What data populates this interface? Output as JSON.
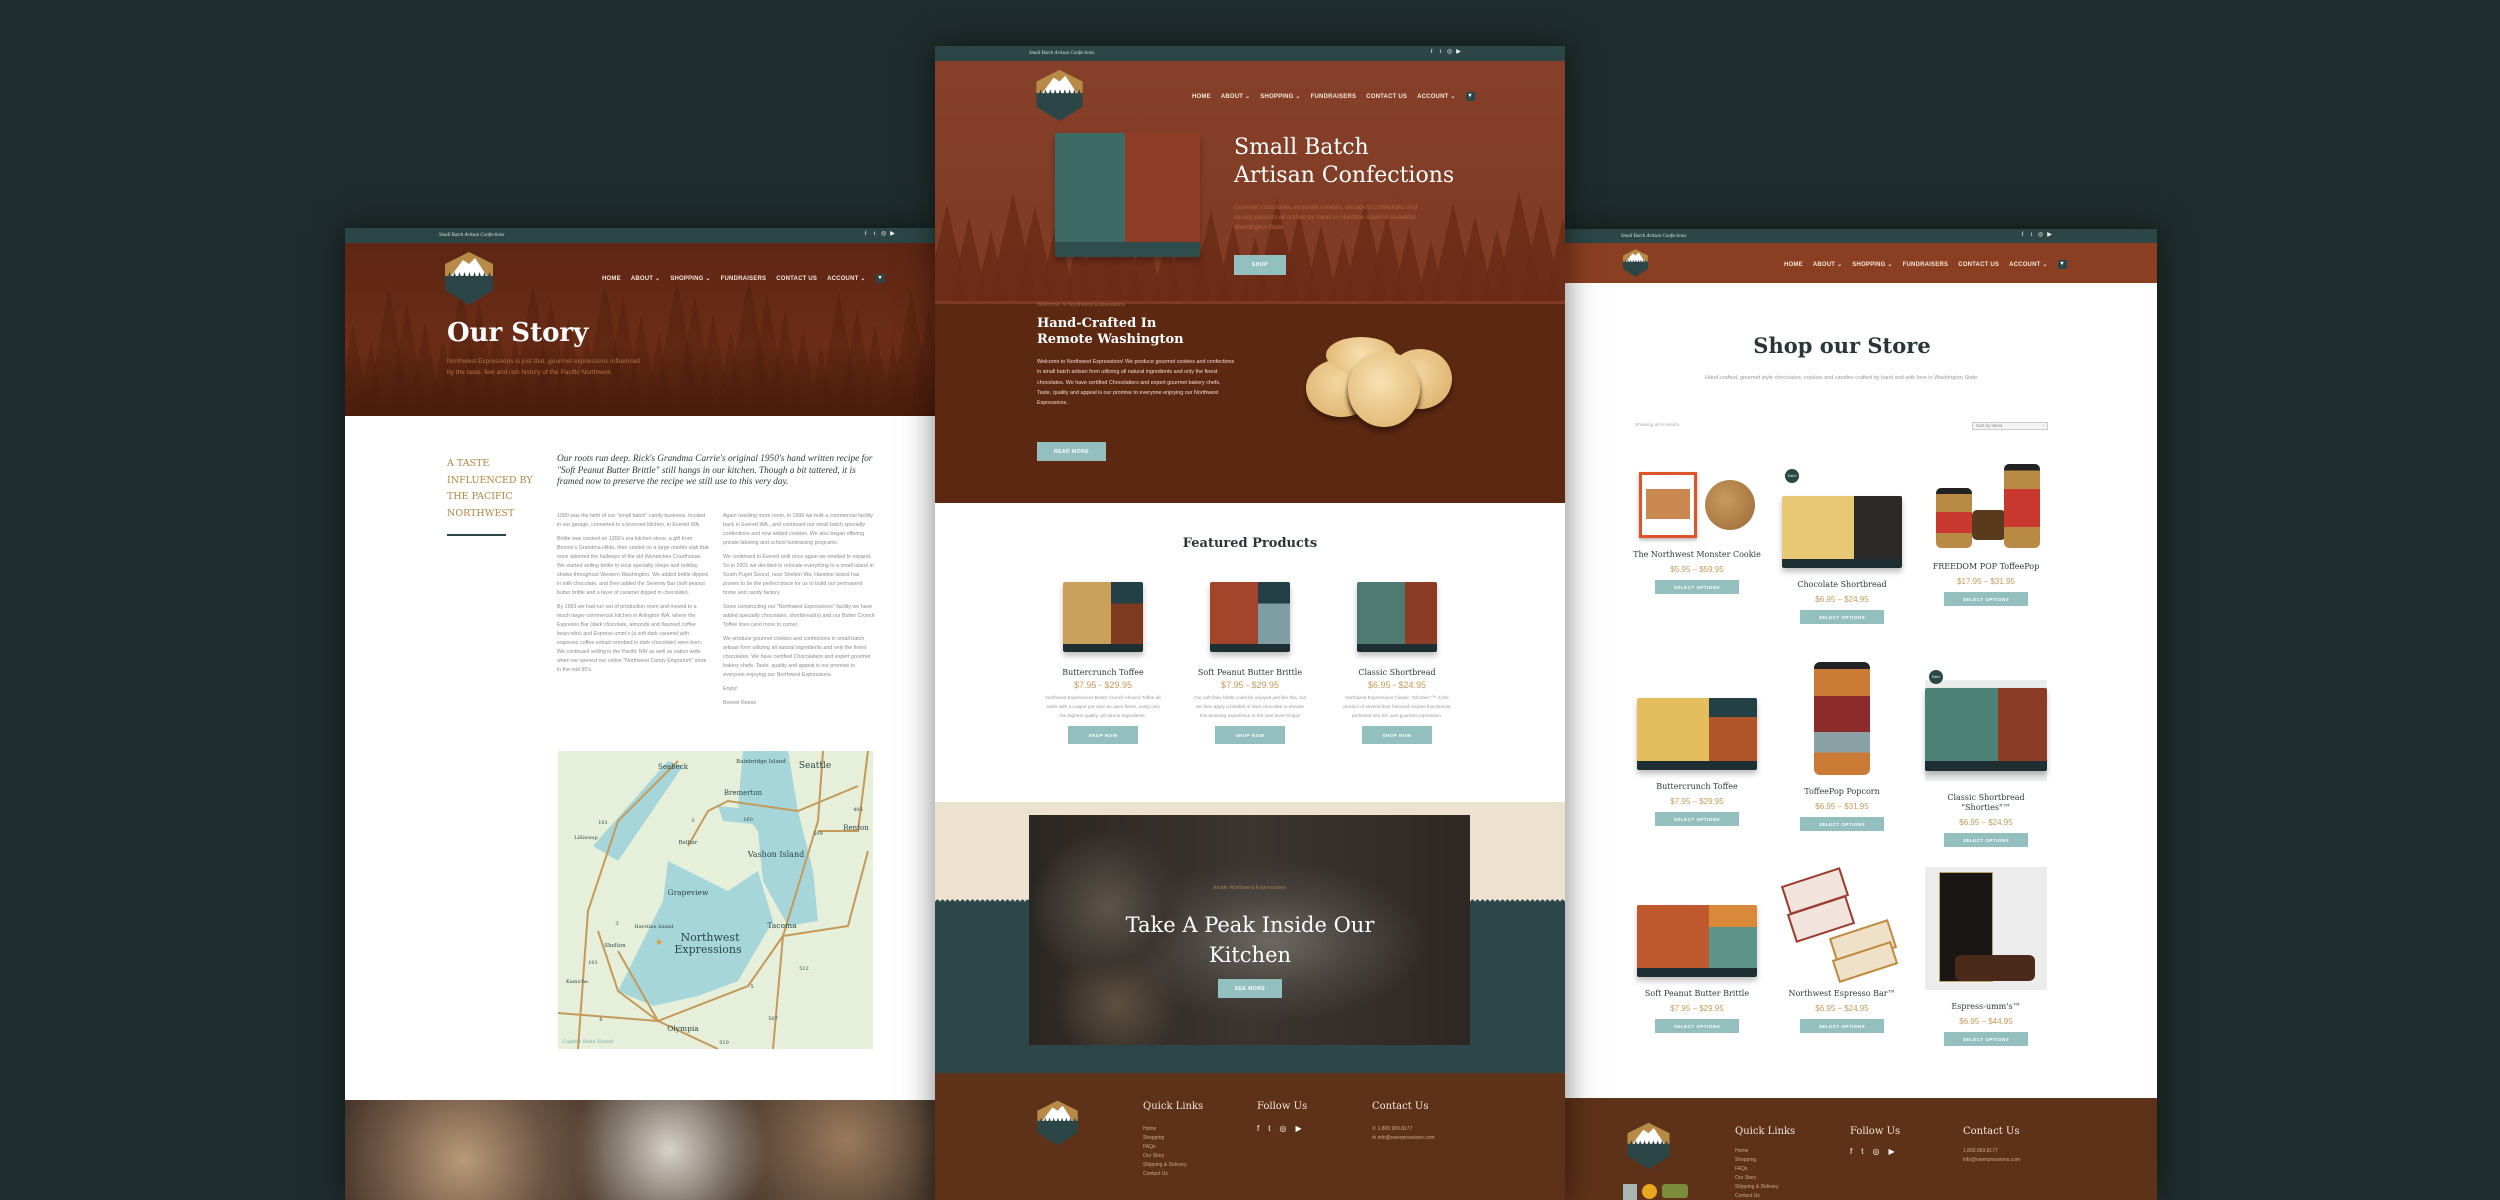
{
  "brand": {
    "name": "Northwest Expressions",
    "tagline": "Small Batch Artisan Confections",
    "logo_sub": "Cookies & Confections"
  },
  "colors": {
    "background": "#1f2c2d",
    "topbar": "#2c4647",
    "brown": "#823a1f",
    "dark_brown": "#5c2812",
    "footer": "#5e3219",
    "button": "#94bfbf",
    "gold": "#c49a5a",
    "cream": "#ede2d0"
  },
  "nav": {
    "items": [
      "HOME",
      "ABOUT",
      "SHOPPING",
      "FUNDRAISERS",
      "CONTACT US",
      "ACCOUNT"
    ],
    "cart_icon": "cart-icon",
    "cart_count": "0"
  },
  "social_icons": [
    "facebook-icon",
    "twitter-icon",
    "instagram-icon",
    "youtube-icon"
  ],
  "story": {
    "title": "Our Story",
    "subtitle": "Northwest Expressions is just that, gourmet expressions influenced by the taste, feel and rich history of the Pacific Northwest.",
    "side_heading": "A TASTE INFLUENCED BY THE PACIFIC NORTHWEST",
    "quote": "Our roots run deep. Rick's Grandma Carrie's original 1950's hand written recipe for \"Soft Peanut Butter Brittle\" still hangs in our kitchen. Though a bit tattered, it is framed now to preserve the recipe we still use to this very day.",
    "col1": [
      "1990 was the birth of our \"small batch\" candy business, located in our garage, converted to a licensed kitchen, in Everett WA.",
      "Brittle was cooked on 1950's era kitchen stove, a gift from Bonnie's Grandma Hilda, then cooled on a large marble slab that once adorned the hallways of the old Wenatchee Courthouse. We started selling brittle in local specialty shops and holiday shows throughout Western Washington. We added brittle dipped in milk chocolate, and then added the Serenity Bar (soft peanut butter brittle and a layer of caramel dipped in chocolate).",
      "By 1993 we had run out of production room and moved to a much larger commercial kitchen in Arlington WA, where the Espresso Bar (dark chocolate, almonds and flavored coffee bean nibs) and Espress-umm's (a soft dark caramel with espresso coffee extract enrobed in dark chocolate) were born. We continued selling in the Pacific NW as well as nation wide when we opened our online \"Northwest Candy Emporium\" store in the mid 90's."
    ],
    "col2": [
      "Again needing more room, in 1996 we built a commercial facility back in Everett WA., and continued our small batch specialty confections and now added cookies. We also began offering private labeling and school fundraising programs.",
      "We continued in Everett until once again we needed to expand. So in 2001 we decided to relocate everything to a small island in South Puget Sound, near Shelton Wa. Harstine Island has proven to be the perfect place for us to build our permanent home and candy factory.",
      "Since constructing our \"Northwest Expressions\" facility we have added specialty chocolates, shortbread(s) and our Butter Crunch Toffee lines (and more to come).",
      "We produce gourmet cookies and confections in small batch artisan form utilizing all natural ingredients and only the finest chocolates. We have certified Chocolatiers and expert gourmet bakery chefs. Taste, quality and appeal is our promise to everyone enjoying our Northwest Expressions.",
      "Enjoy!",
      "Bonnie Reese"
    ],
    "map_labels": [
      "Seabeck",
      "Bainbridge Island",
      "Seattle",
      "Bremerton",
      "101",
      "3",
      "160",
      "509",
      "Renton",
      "405",
      "Lilliwaup",
      "Belfair",
      "Vashon Island",
      "Grapeview",
      "Tacoma",
      "3",
      "Harstine Island",
      "Northwest",
      "Expressions",
      "Shelton",
      "101",
      "512",
      "Kamiche",
      "5",
      "8",
      "Olympia",
      "507",
      "Capitol State Forest",
      "510"
    ]
  },
  "home": {
    "hero_title_1": "Small Batch",
    "hero_title_2": "Artisan Confections",
    "hero_text": "Gourmet chocolates, exquisite cookies, decadent confections and savory popcorn all crafted by hand on Harstine Island in beautiful Washington State.",
    "shop_button": "SHOP",
    "welcome_label": "Welcome To Northwest Expressions",
    "welcome_title": "Hand-Crafted In Remote Washington",
    "welcome_text": "Welcome to Northwest Expressions! We produce gourmet cookies and confections in small batch artisan form utilizing all natural ingredients and only the finest chocolates. We have certified Chocolatiers and expert gourmet bakery chefs. Taste, quality and appeal is our promise to everyone enjoying our Northwest Expressions.",
    "read_more": "READ MORE",
    "featured_title": "Featured Products",
    "featured": [
      {
        "name": "Buttercrunch Toffee",
        "price": "$7.95 - $29.95",
        "desc": "Northwest Expressions Butter Crunch Almond Toffee all starts with a copper pot over an open flame, using only the highest quality, all natural ingredients.",
        "button": "SHOP NOW"
      },
      {
        "name": "Soft Peanut Butter Brittle",
        "price": "$7.95 - $29.95",
        "desc": "Our soft flaky brittle could be enjoyed just like this, but we then apply a blanket of dark chocolate to elevate this amazing experience to the next level! Enjoy!",
        "button": "SHOP NOW"
      },
      {
        "name": "Classic Shortbread",
        "price": "$6.95 - $24.95",
        "desc": "Northwest Expressions Classic \"Shorties\"™ is the product of several time honored recipes that Bonnie perfected into her own gourmet expression.",
        "button": "SHOP NOW"
      }
    ],
    "kitchen_label": "Inside Northwest Expressions",
    "kitchen_title": "Take A Peak Inside Our Kitchen",
    "see_more": "SEE MORE"
  },
  "shop": {
    "title": "Shop our Store",
    "subtitle": "Hand-crafted, gourmet style chocolates, cookies and candies crafted by hand and with love in Washington State.",
    "results": "Showing all 9 results",
    "sort": "Sort by latest",
    "sale_badge": "Sale!",
    "products": [
      {
        "name": "The Northwest Monster Cookie",
        "price": "$5.95 – $59.95",
        "button": "SELECT OPTIONS"
      },
      {
        "name": "Chocolate Shortbread",
        "price": "$6.95 – $24.95",
        "button": "SELECT OPTIONS",
        "sale": true
      },
      {
        "name": "FREEDOM POP ToffeePop",
        "price": "$17.95 – $31.95",
        "button": "SELECT OPTIONS"
      },
      {
        "name": "Buttercrunch Toffee",
        "price": "$7.95 – $29.95",
        "button": "SELECT OPTIONS"
      },
      {
        "name": "ToffeePop Popcorn",
        "price": "$6.95 – $31.95",
        "button": "SELECT OPTIONS"
      },
      {
        "name": "Classic Shortbread \"Shorties\"™",
        "price": "$6.95 – $24.95",
        "button": "SELECT OPTIONS",
        "sale": true
      },
      {
        "name": "Soft Peanut Butter Brittle",
        "price": "$7.95 – $29.95",
        "button": "SELECT OPTIONS"
      },
      {
        "name": "Northwest Espresso Bar™",
        "price": "$6.95 – $24.95",
        "button": "SELECT OPTIONS"
      },
      {
        "name": "Espress-umm's™",
        "price": "$6.95 – $44.95",
        "button": "SELECT OPTIONS"
      }
    ]
  },
  "footer": {
    "quick_links_title": "Quick Links",
    "quick_links": [
      "Home",
      "Shopping",
      "FAQs",
      "Our Story",
      "Shipping & Delivery",
      "Contact Us"
    ],
    "follow_title": "Follow Us",
    "contact_title": "Contact Us",
    "phone": "1.800.969.8177",
    "email": "info@nwexpressions.com"
  }
}
